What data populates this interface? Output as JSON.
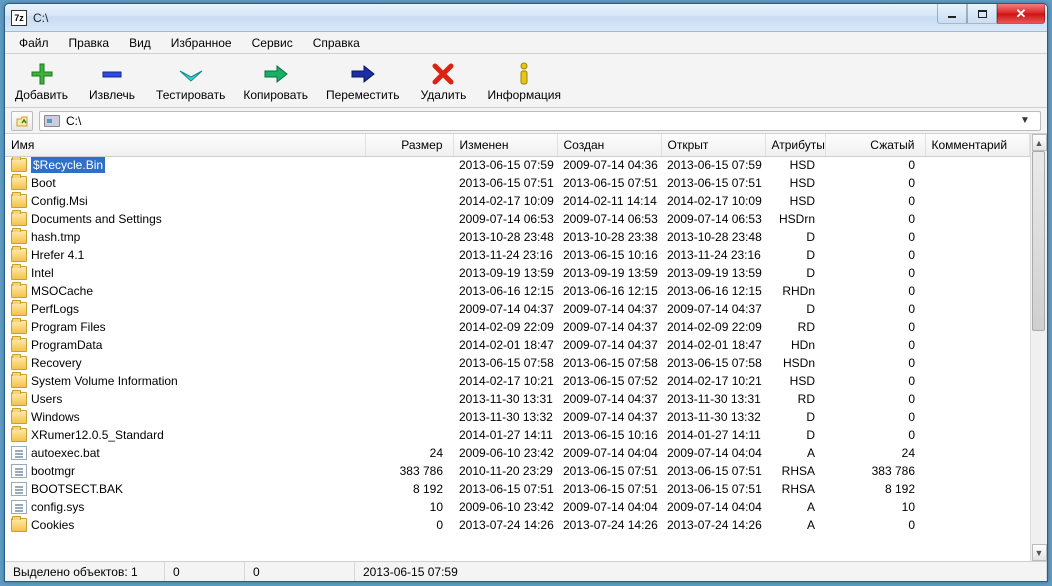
{
  "titlebar": {
    "title": "C:\\"
  },
  "menu": {
    "file": "Файл",
    "edit": "Правка",
    "view": "Вид",
    "favorites": "Избранное",
    "service": "Сервис",
    "help": "Справка"
  },
  "toolbar": {
    "add": "Добавить",
    "extract": "Извлечь",
    "test": "Тестировать",
    "copy": "Копировать",
    "move": "Переместить",
    "delete": "Удалить",
    "info": "Информация"
  },
  "address": {
    "path": "C:\\"
  },
  "columns": {
    "name": "Имя",
    "size": "Размер",
    "modified": "Изменен",
    "created": "Создан",
    "opened": "Открыт",
    "attrs": "Атрибуты",
    "packed": "Сжатый",
    "comment": "Комментарий"
  },
  "rows": [
    {
      "type": "folder",
      "name": "$Recycle.Bin",
      "size": "",
      "modified": "2013-06-15 07:59",
      "created": "2009-07-14 04:36",
      "opened": "2013-06-15 07:59",
      "attrs": "HSD",
      "packed": "0",
      "selected": true
    },
    {
      "type": "folder",
      "name": "Boot",
      "size": "",
      "modified": "2013-06-15 07:51",
      "created": "2013-06-15 07:51",
      "opened": "2013-06-15 07:51",
      "attrs": "HSD",
      "packed": "0"
    },
    {
      "type": "folder",
      "name": "Config.Msi",
      "size": "",
      "modified": "2014-02-17 10:09",
      "created": "2014-02-11 14:14",
      "opened": "2014-02-17 10:09",
      "attrs": "HSD",
      "packed": "0"
    },
    {
      "type": "folder",
      "name": "Documents and Settings",
      "size": "",
      "modified": "2009-07-14 06:53",
      "created": "2009-07-14 06:53",
      "opened": "2009-07-14 06:53",
      "attrs": "HSDrn",
      "packed": "0"
    },
    {
      "type": "folder",
      "name": "hash.tmp",
      "size": "",
      "modified": "2013-10-28 23:48",
      "created": "2013-10-28 23:38",
      "opened": "2013-10-28 23:48",
      "attrs": "D",
      "packed": "0"
    },
    {
      "type": "folder",
      "name": "Hrefer 4.1",
      "size": "",
      "modified": "2013-11-24 23:16",
      "created": "2013-06-15 10:16",
      "opened": "2013-11-24 23:16",
      "attrs": "D",
      "packed": "0"
    },
    {
      "type": "folder",
      "name": "Intel",
      "size": "",
      "modified": "2013-09-19 13:59",
      "created": "2013-09-19 13:59",
      "opened": "2013-09-19 13:59",
      "attrs": "D",
      "packed": "0"
    },
    {
      "type": "folder",
      "name": "MSOCache",
      "size": "",
      "modified": "2013-06-16 12:15",
      "created": "2013-06-16 12:15",
      "opened": "2013-06-16 12:15",
      "attrs": "RHDn",
      "packed": "0"
    },
    {
      "type": "folder",
      "name": "PerfLogs",
      "size": "",
      "modified": "2009-07-14 04:37",
      "created": "2009-07-14 04:37",
      "opened": "2009-07-14 04:37",
      "attrs": "D",
      "packed": "0"
    },
    {
      "type": "folder",
      "name": "Program Files",
      "size": "",
      "modified": "2014-02-09 22:09",
      "created": "2009-07-14 04:37",
      "opened": "2014-02-09 22:09",
      "attrs": "RD",
      "packed": "0"
    },
    {
      "type": "folder",
      "name": "ProgramData",
      "size": "",
      "modified": "2014-02-01 18:47",
      "created": "2009-07-14 04:37",
      "opened": "2014-02-01 18:47",
      "attrs": "HDn",
      "packed": "0"
    },
    {
      "type": "folder",
      "name": "Recovery",
      "size": "",
      "modified": "2013-06-15 07:58",
      "created": "2013-06-15 07:58",
      "opened": "2013-06-15 07:58",
      "attrs": "HSDn",
      "packed": "0"
    },
    {
      "type": "folder",
      "name": "System Volume Information",
      "size": "",
      "modified": "2014-02-17 10:21",
      "created": "2013-06-15 07:52",
      "opened": "2014-02-17 10:21",
      "attrs": "HSD",
      "packed": "0"
    },
    {
      "type": "folder",
      "name": "Users",
      "size": "",
      "modified": "2013-11-30 13:31",
      "created": "2009-07-14 04:37",
      "opened": "2013-11-30 13:31",
      "attrs": "RD",
      "packed": "0"
    },
    {
      "type": "folder",
      "name": "Windows",
      "size": "",
      "modified": "2013-11-30 13:32",
      "created": "2009-07-14 04:37",
      "opened": "2013-11-30 13:32",
      "attrs": "D",
      "packed": "0"
    },
    {
      "type": "folder",
      "name": "XRumer12.0.5_Standard",
      "size": "",
      "modified": "2014-01-27 14:11",
      "created": "2013-06-15 10:16",
      "opened": "2014-01-27 14:11",
      "attrs": "D",
      "packed": "0"
    },
    {
      "type": "file",
      "name": "autoexec.bat",
      "size": "24",
      "modified": "2009-06-10 23:42",
      "created": "2009-07-14 04:04",
      "opened": "2009-07-14 04:04",
      "attrs": "A",
      "packed": "24"
    },
    {
      "type": "file",
      "name": "bootmgr",
      "size": "383 786",
      "modified": "2010-11-20 23:29",
      "created": "2013-06-15 07:51",
      "opened": "2013-06-15 07:51",
      "attrs": "RHSA",
      "packed": "383 786"
    },
    {
      "type": "file",
      "name": "BOOTSECT.BAK",
      "size": "8 192",
      "modified": "2013-06-15 07:51",
      "created": "2013-06-15 07:51",
      "opened": "2013-06-15 07:51",
      "attrs": "RHSA",
      "packed": "8 192"
    },
    {
      "type": "file",
      "name": "config.sys",
      "size": "10",
      "modified": "2009-06-10 23:42",
      "created": "2009-07-14 04:04",
      "opened": "2009-07-14 04:04",
      "attrs": "A",
      "packed": "10"
    },
    {
      "type": "folder",
      "name": "Cookies",
      "size": "0",
      "modified": "2013-07-24 14:26",
      "created": "2013-07-24 14:26",
      "opened": "2013-07-24 14:26",
      "attrs": "A",
      "packed": "0"
    }
  ],
  "status": {
    "sel": "Выделено объектов: 1",
    "c1": "0",
    "c2": "0",
    "c3": "2013-06-15 07:59"
  }
}
